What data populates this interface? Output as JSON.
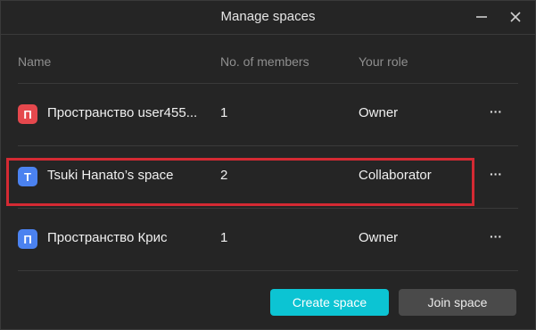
{
  "dialog": {
    "title": "Manage spaces"
  },
  "window_controls": {
    "minimize_icon": "minimize-icon",
    "close_icon": "close-icon"
  },
  "table": {
    "headers": {
      "name": "Name",
      "members": "No. of members",
      "role": "Your role"
    },
    "rows": [
      {
        "avatar_letter": "П",
        "avatar_color": "#e5484d",
        "name": "Пространство user455...",
        "members": "1",
        "role": "Owner",
        "more": "···"
      },
      {
        "avatar_letter": "T",
        "avatar_color": "#4b82f0",
        "name": "Tsuki Hanato’s space",
        "members": "2",
        "role": "Collaborator",
        "more": "···"
      },
      {
        "avatar_letter": "П",
        "avatar_color": "#4b82f0",
        "name": "Пространство Крис",
        "members": "1",
        "role": "Owner",
        "more": "···"
      }
    ]
  },
  "actions": {
    "create_label": "Create space",
    "join_label": "Join space"
  },
  "colors": {
    "accent": "#0cc4d3",
    "highlight": "#d42a33",
    "background": "#252525"
  }
}
